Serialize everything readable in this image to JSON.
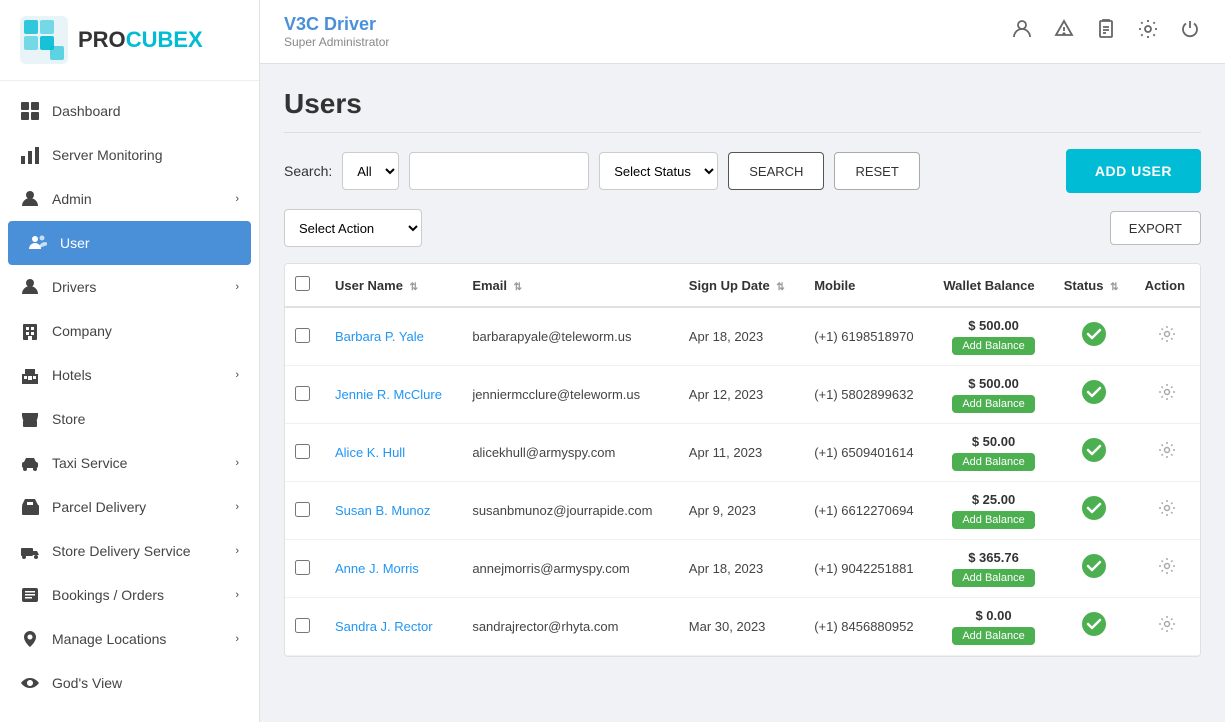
{
  "sidebar": {
    "logo_text_1": "PRO",
    "logo_text_2": "CUBEX",
    "items": [
      {
        "id": "dashboard",
        "label": "Dashboard",
        "icon": "grid",
        "active": false,
        "hasChevron": false
      },
      {
        "id": "server-monitoring",
        "label": "Server Monitoring",
        "icon": "bar-chart",
        "active": false,
        "hasChevron": false
      },
      {
        "id": "admin",
        "label": "Admin",
        "icon": "person",
        "active": false,
        "hasChevron": true
      },
      {
        "id": "user",
        "label": "User",
        "icon": "person-group",
        "active": true,
        "hasChevron": false
      },
      {
        "id": "drivers",
        "label": "Drivers",
        "icon": "person",
        "active": false,
        "hasChevron": true
      },
      {
        "id": "company",
        "label": "Company",
        "icon": "building",
        "active": false,
        "hasChevron": false
      },
      {
        "id": "hotels",
        "label": "Hotels",
        "icon": "hotel",
        "active": false,
        "hasChevron": true
      },
      {
        "id": "store",
        "label": "Store",
        "icon": "store",
        "active": false,
        "hasChevron": false
      },
      {
        "id": "taxi-service",
        "label": "Taxi Service",
        "icon": "car",
        "active": false,
        "hasChevron": true
      },
      {
        "id": "parcel-delivery",
        "label": "Parcel Delivery",
        "icon": "truck",
        "active": false,
        "hasChevron": true
      },
      {
        "id": "store-delivery",
        "label": "Store Delivery Service",
        "icon": "truck2",
        "active": false,
        "hasChevron": true
      },
      {
        "id": "bookings",
        "label": "Bookings / Orders",
        "icon": "list",
        "active": false,
        "hasChevron": true
      },
      {
        "id": "manage-locations",
        "label": "Manage Locations",
        "icon": "location",
        "active": false,
        "hasChevron": true
      },
      {
        "id": "gods-view",
        "label": "God's View",
        "icon": "eye",
        "active": false,
        "hasChevron": false
      }
    ]
  },
  "header": {
    "app_name": "V3C Driver",
    "role": "Super Administrator"
  },
  "page": {
    "title": "Users"
  },
  "search": {
    "label": "Search:",
    "type_placeholder": "All",
    "status_placeholder": "Select Status",
    "search_btn": "SEARCH",
    "reset_btn": "RESET",
    "add_user_btn": "ADD USER"
  },
  "actions": {
    "select_action": "Select Action",
    "export_btn": "EXPORT"
  },
  "table": {
    "columns": [
      {
        "key": "username",
        "label": "User Name"
      },
      {
        "key": "email",
        "label": "Email"
      },
      {
        "key": "signup_date",
        "label": "Sign Up Date"
      },
      {
        "key": "mobile",
        "label": "Mobile"
      },
      {
        "key": "wallet_balance",
        "label": "Wallet Balance"
      },
      {
        "key": "status",
        "label": "Status"
      },
      {
        "key": "action",
        "label": "Action"
      }
    ],
    "rows": [
      {
        "id": 1,
        "username": "Barbara P. Yale",
        "email": "barbarapyale@teleworm.us",
        "signup_date": "Apr 18, 2023",
        "mobile": "(+1) 6198518970",
        "balance": "$ 500.00",
        "status": "active"
      },
      {
        "id": 2,
        "username": "Jennie R. McClure",
        "email": "jenniermcclure@teleworm.us",
        "signup_date": "Apr 12, 2023",
        "mobile": "(+1) 5802899632",
        "balance": "$ 500.00",
        "status": "active"
      },
      {
        "id": 3,
        "username": "Alice K. Hull",
        "email": "alicekhull@armyspy.com",
        "signup_date": "Apr 11, 2023",
        "mobile": "(+1) 6509401614",
        "balance": "$ 50.00",
        "status": "active"
      },
      {
        "id": 4,
        "username": "Susan B. Munoz",
        "email": "susanbmunoz@jourrapide.com",
        "signup_date": "Apr 9, 2023",
        "mobile": "(+1) 6612270694",
        "balance": "$ 25.00",
        "status": "active"
      },
      {
        "id": 5,
        "username": "Anne J. Morris",
        "email": "annejmorris@armyspy.com",
        "signup_date": "Apr 18, 2023",
        "mobile": "(+1) 9042251881",
        "balance": "$ 365.76",
        "status": "active"
      },
      {
        "id": 6,
        "username": "Sandra J. Rector",
        "email": "sandrajrector@rhyta.com",
        "signup_date": "Mar 30, 2023",
        "mobile": "(+1) 8456880952",
        "balance": "$ 0.00",
        "status": "active"
      }
    ],
    "add_balance_label": "Add Balance"
  }
}
